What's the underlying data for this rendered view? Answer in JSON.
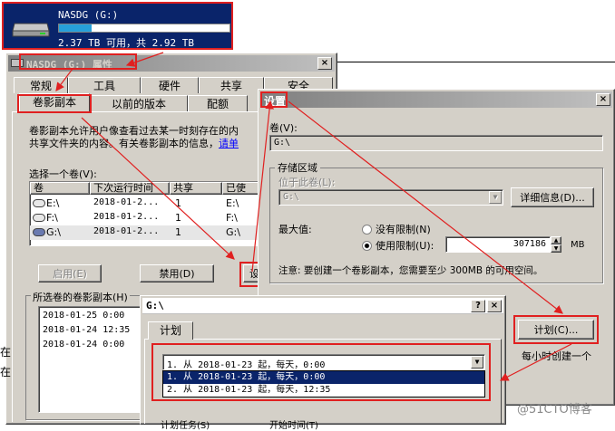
{
  "drive_card": {
    "name": "NASDG (G:)",
    "usage": "2.37 TB 可用，共 2.92 TB",
    "used_fraction": 0.19
  },
  "props": {
    "title": "NASDG (G:) 属性",
    "tabs_row1": [
      "常规",
      "工具",
      "硬件",
      "共享",
      "安全"
    ],
    "tabs_row2": [
      "卷影副本",
      "以前的版本",
      "配额"
    ],
    "desc_line1": "卷影副本允许用户像查看过去某一时刻存在的内",
    "desc_line2": "共享文件夹的内容。有关卷影副本的信息，",
    "desc_link": "请单",
    "select_label": "选择一个卷(V):",
    "columns": [
      "卷",
      "下次运行时间",
      "共享",
      "已使"
    ],
    "rows": [
      {
        "vol": "E:\\",
        "next": "2018-01-2...",
        "shares": "1",
        "used": "E:\\"
      },
      {
        "vol": "F:\\",
        "next": "2018-01-2...",
        "shares": "1",
        "used": "F:\\"
      },
      {
        "vol": "G:\\",
        "next": "2018-01-2...",
        "shares": "1",
        "used": "G:\\"
      }
    ],
    "enable_btn": "启用(E)",
    "disable_btn": "禁用(D)",
    "settings_btn": "设",
    "copies_label": "所选卷的卷影副本(H)",
    "copies": [
      "2018-01-25 0:00",
      "2018-01-24 12:35",
      "2018-01-24 0:00"
    ],
    "left_cut1": "在",
    "left_cut2": "在"
  },
  "settings": {
    "title": "设置",
    "vol_label": "卷(V):",
    "vol_value": "G:\\",
    "storage_group": "存储区域",
    "located_label": "位于此卷(L):",
    "located_value": "G:\\",
    "details_btn": "详细信息(D)...",
    "max_label": "最大值:",
    "no_limit": "没有限制(N)",
    "use_limit": "使用限制(U):",
    "limit_value": "307186",
    "unit": "MB",
    "note": "注意: 要创建一个卷影副本，您需要至少 300MB 的可用空间。",
    "schedule_btn": "计划(C)...",
    "hourly_note": "每小时创建一个"
  },
  "schedule": {
    "title": "G:\\",
    "help": "?",
    "close": "×",
    "tab": "计划",
    "selected": "1. 从 2018-01-23 起，每天，0:00",
    "options": [
      "1. 从 2018-01-23 起，每天，0:00",
      "2. 从 2018-01-23 起，每天，12:35"
    ],
    "bottom_left": "计划任务(S)",
    "bottom_right": "开始时间(T)"
  },
  "watermark": "@51CTO博客"
}
